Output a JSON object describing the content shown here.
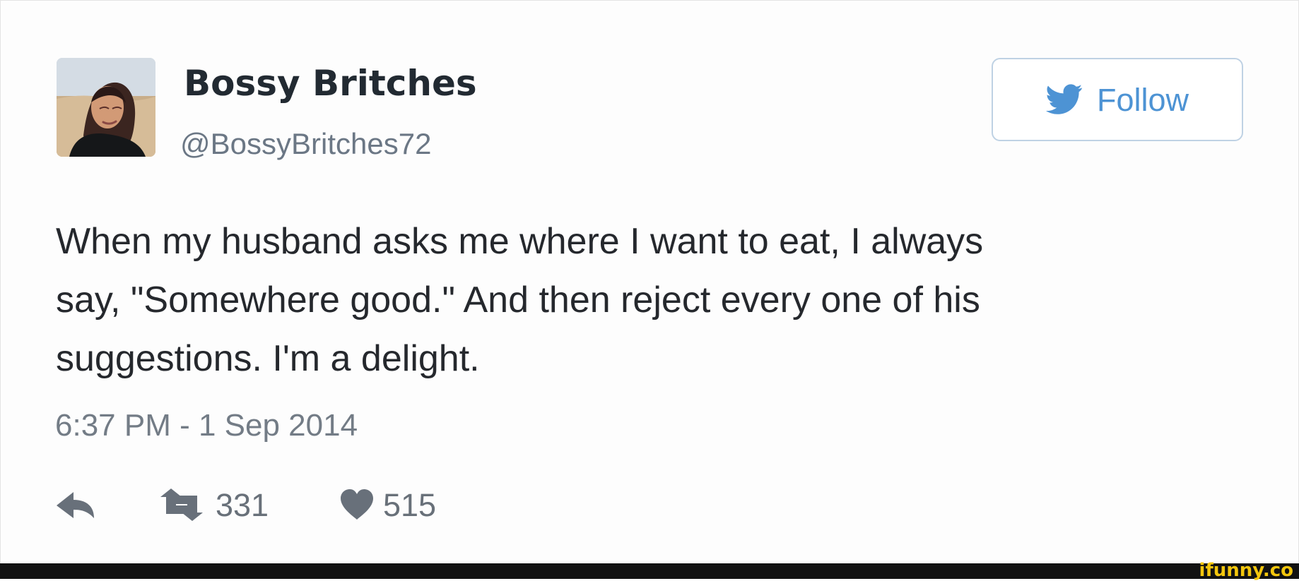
{
  "profile": {
    "display_name": "Bossy Britches",
    "handle": "@BossyBritches72",
    "avatar_icon": "profile-photo"
  },
  "follow_button": {
    "label": "Follow",
    "icon": "twitter-bird-icon",
    "color": "#4d93d4"
  },
  "tweet": {
    "lines": [
      "When my husband asks me where I want to eat, I always",
      "say, \"Somewhere good.\" And then reject every one of his",
      "suggestions. I'm a delight."
    ],
    "timestamp": "6:37 PM - 1 Sep 2014"
  },
  "actions": {
    "reply_icon": "reply-icon",
    "retweet_icon": "retweet-icon",
    "retweets": "331",
    "like_icon": "heart-icon",
    "likes": "515"
  },
  "watermark": {
    "text": "ifunny.co",
    "color": "#f3c60d"
  }
}
